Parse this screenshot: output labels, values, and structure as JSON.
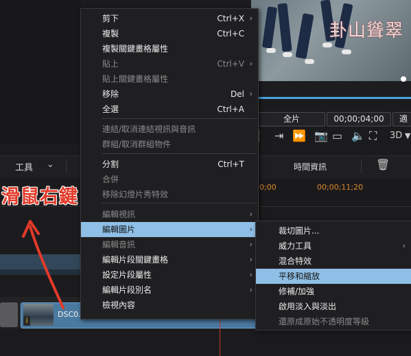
{
  "preview": {
    "watermark": "卦山聳翠"
  },
  "controls": {
    "quality_label": "全片",
    "timecode": "00;00;04;00",
    "fit_label": "適",
    "view_3d_label": "3D"
  },
  "toolbar": {
    "tools_label": "工具",
    "time_info_label": "時間資訊"
  },
  "ruler": {
    "ticks": [
      "0;00",
      "00;00;11;20"
    ]
  },
  "timeline": {
    "clip_name": "DSC0.....",
    "clip_badge": "i"
  },
  "annotation": {
    "text": "滑鼠右鍵"
  },
  "context_menu": {
    "items": [
      {
        "label": "剪下",
        "shortcut": "Ctrl+X",
        "submenu": true,
        "enabled": true
      },
      {
        "label": "複製",
        "shortcut": "Ctrl+C",
        "submenu": false,
        "enabled": true
      },
      {
        "label": "複製關鍵畫格屬性",
        "shortcut": "",
        "submenu": false,
        "enabled": true
      },
      {
        "label": "貼上",
        "shortcut": "Ctrl+V",
        "submenu": true,
        "enabled": false
      },
      {
        "label": "貼上關鍵畫格屬性",
        "shortcut": "",
        "submenu": false,
        "enabled": false
      },
      {
        "label": "移除",
        "shortcut": "Del",
        "submenu": true,
        "enabled": true
      },
      {
        "label": "全選",
        "shortcut": "Ctrl+A",
        "submenu": false,
        "enabled": true
      },
      {
        "label": "連結/取消連結視訊與音訊",
        "shortcut": "",
        "submenu": false,
        "enabled": false
      },
      {
        "label": "群組/取消群組物件",
        "shortcut": "",
        "submenu": false,
        "enabled": false
      },
      {
        "label": "分割",
        "shortcut": "Ctrl+T",
        "submenu": false,
        "enabled": true
      },
      {
        "label": "合併",
        "shortcut": "",
        "submenu": false,
        "enabled": false
      },
      {
        "label": "移除幻燈片秀特效",
        "shortcut": "",
        "submenu": false,
        "enabled": false
      },
      {
        "label": "編輯視訊",
        "shortcut": "",
        "submenu": true,
        "enabled": false
      },
      {
        "label": "編輯圖片",
        "shortcut": "",
        "submenu": true,
        "enabled": true,
        "selected": true
      },
      {
        "label": "編輯音訊",
        "shortcut": "",
        "submenu": true,
        "enabled": false
      },
      {
        "label": "編輯片段關鍵畫格",
        "shortcut": "",
        "submenu": true,
        "enabled": true
      },
      {
        "label": "設定片段屬性",
        "shortcut": "",
        "submenu": true,
        "enabled": true
      },
      {
        "label": "編輯片段別名",
        "shortcut": "",
        "submenu": true,
        "enabled": true
      },
      {
        "label": "檢視內容",
        "shortcut": "",
        "submenu": false,
        "enabled": true
      }
    ]
  },
  "submenu": {
    "items": [
      {
        "label": "裁切圖片...",
        "submenu": false,
        "enabled": true
      },
      {
        "label": "威力工具",
        "submenu": true,
        "enabled": true
      },
      {
        "label": "混合特效",
        "submenu": false,
        "enabled": true
      },
      {
        "label": "平移和縮放",
        "submenu": false,
        "enabled": true,
        "selected": true
      },
      {
        "label": "修補/加強",
        "submenu": false,
        "enabled": true
      },
      {
        "label": "啟用淡入與淡出",
        "submenu": false,
        "enabled": true
      },
      {
        "label": "還原成原始不透明度等級",
        "submenu": false,
        "enabled": false
      }
    ]
  },
  "colors": {
    "highlight": "#8fbfe6",
    "annotation": "#e23a2a",
    "playhead": "#c0392b"
  }
}
